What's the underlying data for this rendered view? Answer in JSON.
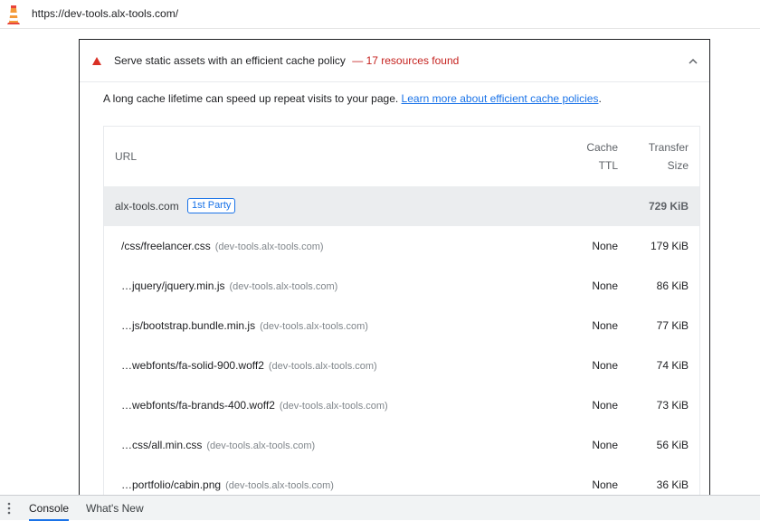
{
  "address_bar": {
    "url": "https://dev-tools.alx-tools.com/"
  },
  "audit": {
    "title": "Serve static assets with an efficient cache policy",
    "display_value": "— 17 resources found",
    "description": "A long cache lifetime can speed up repeat visits to your page.",
    "learn_more": "Learn more about efficient cache policies",
    "description_end": "."
  },
  "table": {
    "headers": {
      "url": "URL",
      "cache_ttl": [
        "Cache",
        "TTL"
      ],
      "transfer_size": [
        "Transfer",
        "Size"
      ]
    },
    "group": {
      "name": "alx-tools.com",
      "badge": "1st Party",
      "size": "729 KiB"
    },
    "rows": [
      {
        "path": "/css/freelancer.css",
        "host": "(dev-tools.alx-tools.com)",
        "ttl": "None",
        "size": "179 KiB"
      },
      {
        "path": "…jquery/jquery.min.js",
        "host": "(dev-tools.alx-tools.com)",
        "ttl": "None",
        "size": "86 KiB"
      },
      {
        "path": "…js/bootstrap.bundle.min.js",
        "host": "(dev-tools.alx-tools.com)",
        "ttl": "None",
        "size": "77 KiB"
      },
      {
        "path": "…webfonts/fa-solid-900.woff2",
        "host": "(dev-tools.alx-tools.com)",
        "ttl": "None",
        "size": "74 KiB"
      },
      {
        "path": "…webfonts/fa-brands-400.woff2",
        "host": "(dev-tools.alx-tools.com)",
        "ttl": "None",
        "size": "73 KiB"
      },
      {
        "path": "…css/all.min.css",
        "host": "(dev-tools.alx-tools.com)",
        "ttl": "None",
        "size": "56 KiB"
      },
      {
        "path": "…portfolio/cabin.png",
        "host": "(dev-tools.alx-tools.com)",
        "ttl": "None",
        "size": "36 KiB"
      }
    ]
  },
  "drawer": {
    "tabs": [
      "Console",
      "What's New"
    ],
    "active_tab": "Console"
  },
  "icons": {
    "logo": "lighthouse-icon",
    "fail": "warning-triangle-icon",
    "collapse": "chevron-up-icon",
    "menu": "more-vertical-icon"
  },
  "colors": {
    "fail_red": "#d93025",
    "link_blue": "#1a73e8",
    "group_bg": "#ebedef"
  }
}
